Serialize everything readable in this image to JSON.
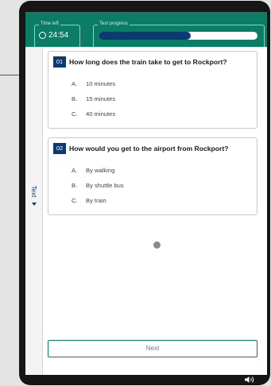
{
  "header": {
    "time_left_label": "Time left",
    "time_value": "24:54",
    "progress_label": "Test progress",
    "progress_fraction": 0.58
  },
  "side_tab": {
    "label": "Text"
  },
  "questions": [
    {
      "number": "01",
      "text": "How long does the train take to get to Rockport?",
      "options": [
        {
          "letter": "A.",
          "text": "10 minutes"
        },
        {
          "letter": "B.",
          "text": "15 minutes"
        },
        {
          "letter": "C.",
          "text": "40 minutes"
        }
      ]
    },
    {
      "number": "02",
      "text": "How would you get to the airport from Rockport?",
      "options": [
        {
          "letter": "A.",
          "text": "By walking"
        },
        {
          "letter": "B.",
          "text": "By shuttle bus"
        },
        {
          "letter": "C.",
          "text": "By train"
        }
      ]
    }
  ],
  "next_button": {
    "label": "Next"
  },
  "colors": {
    "header": "#0b7d64",
    "progress_fill": "#0d3a73",
    "question_badge": "#0d3a73"
  },
  "icons": [
    "timer-icon",
    "speaker-icon",
    "loading-dot"
  ]
}
